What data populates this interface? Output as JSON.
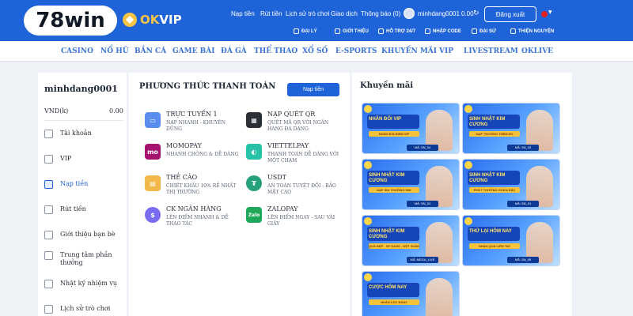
{
  "brand": {
    "logo_text": "78win",
    "partner_ok": "OK",
    "partner_vip": "VIP"
  },
  "topnav": {
    "links": [
      "Nạp tiền",
      "Rút tiền",
      "Lịch sử trò chơi",
      "Giao dịch",
      "Thông báo (0)"
    ],
    "username": "minhdang0001",
    "balance": "0.00",
    "logout_label": "Đăng xuất"
  },
  "subnav": [
    "ĐẠI LÝ",
    "GIỚI THIỆU",
    "HỖ TRỢ 24/7",
    "NHẬP CODE",
    "ĐẠI SỨ",
    "THIỆN NGUYỆN"
  ],
  "categories": [
    "CASINO",
    "NỔ HŨ",
    "BẮN CÁ",
    "GAME BÀI",
    "ĐÁ GÀ",
    "THỂ THAO",
    "XỔ SỐ",
    "E-SPORTS",
    "KHUYẾN MÃI",
    "VIP",
    "LIVESTREAM",
    "OKLIVE"
  ],
  "sidebar": {
    "username": "minhdang0001",
    "currency": "VND(k)",
    "amount": "0.00",
    "items": [
      {
        "label": "Tài khoản",
        "icon": "user-icon"
      },
      {
        "label": "VIP",
        "icon": "vip-icon"
      },
      {
        "label": "Nạp tiền",
        "icon": "deposit-icon"
      },
      {
        "label": "Rút tiền",
        "icon": "withdraw-icon"
      },
      {
        "label": "Giới thiệu bạn bè",
        "icon": "refer-icon"
      },
      {
        "label": "Trung tâm phần thưởng",
        "icon": "reward-icon"
      },
      {
        "label": "Nhật ký nhiệm vụ",
        "icon": "task-icon"
      },
      {
        "label": "Lịch sử trò chơi",
        "icon": "history-icon"
      }
    ]
  },
  "payment": {
    "title": "PHƯƠNG THỨC THANH TOÁN",
    "button_label": "Nạp tiền",
    "methods": [
      {
        "name": "TRỰC TUYẾN 1",
        "desc": "NẠP NHANH - KHUYÊN DÙNG",
        "icon": "card-icon",
        "color": "#5b8def"
      },
      {
        "name": "NẠP QUÉT QR",
        "desc": "QUÉT MÃ QR VỚI NGÂN HÀNG ĐA DẠNG",
        "icon": "qr-icon",
        "color": "#2b2f36"
      },
      {
        "name": "MOMOPAY",
        "desc": "NHANH CHÓNG & DỄ DÀNG",
        "icon": "momo-icon",
        "color": "#a5136e",
        "glyph": "mo"
      },
      {
        "name": "VIETTELPAY",
        "desc": "THANH TOÁN DỄ DÀNG VỚI MỘT CHẠM",
        "icon": "viettelpay-icon",
        "color": "#27c2a8"
      },
      {
        "name": "THẺ CÀO",
        "desc": "CHIẾT KHẤU 10% RẺ NHẤT THỊ TRƯỜNG",
        "icon": "scratch-card-icon",
        "color": "#f2b94a"
      },
      {
        "name": "USDT",
        "desc": "AN TOÀN TUYỆT ĐỐI - BẢO MẬT CAO",
        "icon": "usdt-icon",
        "color": "#26a17b",
        "glyph": "₮"
      },
      {
        "name": "CK NGÂN HÀNG",
        "desc": "LÊN ĐIỂM NHANH & DỄ THAO TÁC",
        "icon": "bank-transfer-icon",
        "color": "#7a6cf0",
        "glyph": "$"
      },
      {
        "name": "ZALOPAY",
        "desc": "LÊN ĐIỂM NGAY - SAU VÀI GIÂY",
        "icon": "zalopay-icon",
        "color": "#1fa85a",
        "glyph": "Zalo"
      }
    ]
  },
  "promotions": {
    "title": "Khuyến mãi",
    "banners": [
      {
        "title": "NHÂN ĐÔI VIP",
        "sub": "NHÂN ĐÔI ĐIỂM VIP",
        "code": "MÃ: SN_04"
      },
      {
        "title": "SINH NHẬT KIM CƯƠNG",
        "sub": "NẠP THƯỞNG THÊM 8%",
        "code": "MÃ: SN_03"
      },
      {
        "title": "SINH NHẬT KIM CƯƠNG",
        "sub": "NẠP SIN THƯỞNG 50K",
        "code": "MÃ: SN_02"
      },
      {
        "title": "SINH NHẬT KIM CƯƠNG",
        "sub": "PHÁT THƯỞNG HOÀN ĐẶC",
        "code": "MÃ: SN_01"
      },
      {
        "title": "SINH NHẬT KIM CƯƠNG",
        "sub": "QUÀ ĐẸP - XE SANG - NỘT XUÂN",
        "code": "MÃ: MEGA_LIVE"
      },
      {
        "title": "THỬ LẠI HÔM NAY",
        "sub": "NHẬN QUÀ LIỀN TAY",
        "code": "MÃ: SN_05"
      },
      {
        "title": "CƯỢC HÔM NAY",
        "sub": "NHẬN LỘC NGAY",
        "code": ""
      }
    ]
  },
  "colors": {
    "primary": "#1f63d8",
    "category_text": "#3b73d3",
    "page_bg": "#eef1f6"
  }
}
